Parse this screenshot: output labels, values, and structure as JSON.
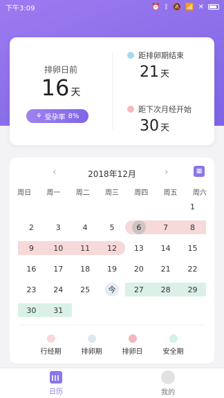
{
  "status": {
    "time": "下午3:09"
  },
  "summary": {
    "before_label": "排卵日前",
    "before_value": "16",
    "before_unit": "天",
    "rate_label": "受孕率",
    "rate_value": "8%",
    "ovulation_end_label": "距排卵期结束",
    "ovulation_end_value": "21",
    "ovulation_end_unit": "天",
    "next_period_label": "距下次月经开始",
    "next_period_value": "30",
    "next_period_unit": "天"
  },
  "calendar": {
    "month": "2018年12月",
    "today_label": "今",
    "weekdays": [
      "周日",
      "周一",
      "周二",
      "周三",
      "周四",
      "周五",
      "周六"
    ],
    "rows": [
      [
        "",
        "",
        "",
        "",
        "",
        "",
        "1"
      ],
      [
        "2",
        "3",
        "4",
        "5",
        "6",
        "7",
        "8"
      ],
      [
        "9",
        "10",
        "11",
        "12",
        "13",
        "14",
        "15"
      ],
      [
        "16",
        "17",
        "18",
        "19",
        "20",
        "21",
        "22"
      ],
      [
        "23",
        "24",
        "25",
        "今",
        "27",
        "28",
        "29"
      ],
      [
        "30",
        "31",
        "",
        "",
        "",
        "",
        ""
      ]
    ]
  },
  "legend": [
    {
      "label": "行经期",
      "color": "#f7d7dc"
    },
    {
      "label": "排卵期",
      "color": "#dde8f5"
    },
    {
      "label": "排卵日",
      "color": "#f3b7bd"
    },
    {
      "label": "安全期",
      "color": "#d7efe4"
    }
  ],
  "tabs": {
    "calendar": "日历",
    "me": "我的"
  },
  "colors": {
    "accent": "#8d75ea",
    "period": "#f6d9d9",
    "ovulation": "#dbf1e7"
  }
}
